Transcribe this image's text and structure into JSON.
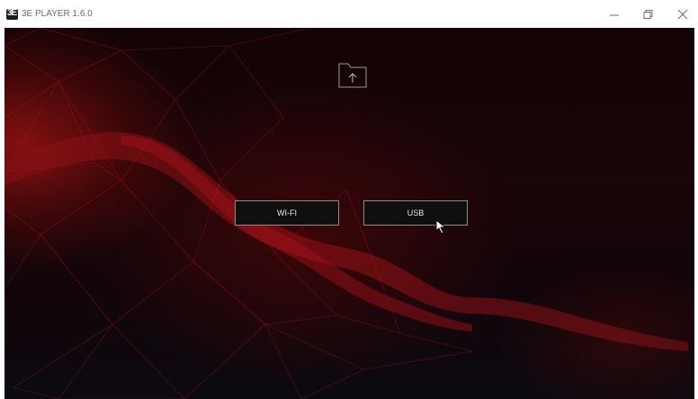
{
  "window": {
    "title": "3E PLAYER 1.6.0",
    "logo_text": "3E",
    "controls": [
      "minimize-icon",
      "restore-icon",
      "close-icon"
    ]
  },
  "main": {
    "upload_icon": "folder-upload-icon",
    "buttons": {
      "wifi_label": "WI-FI",
      "usb_label": "USB"
    }
  },
  "theme": {
    "accent": "#b3141a",
    "background": "#140508",
    "button_border": "#8c8c8c"
  }
}
